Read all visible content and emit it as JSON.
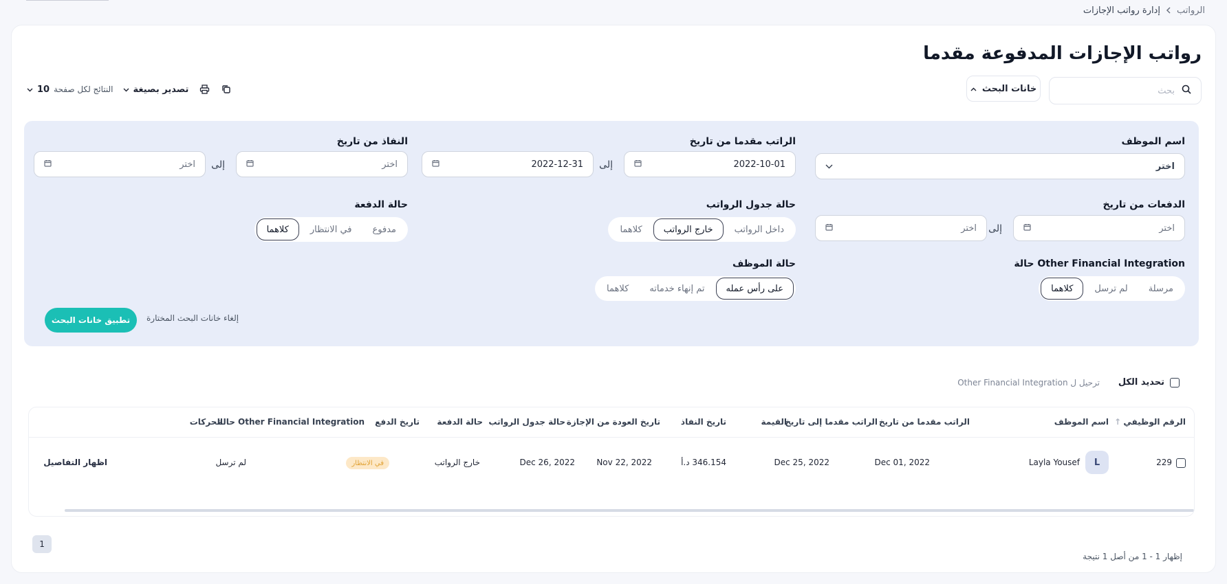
{
  "breadcrumb": {
    "root": "الرواتب",
    "current": "إدارة رواتب الإجازات"
  },
  "page": {
    "title": "رواتب الإجازات المدفوعة مقدما"
  },
  "search": {
    "placeholder": "بحث",
    "fields_button": "خانات البحث"
  },
  "toolbar": {
    "export_label": "تصدير بصيغة",
    "per_page_label": "النتائج لكل صفحة",
    "per_page_value": "10"
  },
  "filters": {
    "employee_name": {
      "label": "اسم الموظف",
      "placeholder": "اختر"
    },
    "advance_from": {
      "label": "الراتب مقدما من تاريخ",
      "from_value": "2022-10-01",
      "to_value": "2022-12-31",
      "to_word": "إلى"
    },
    "effective_from": {
      "label": "النفاذ من تاريخ",
      "from_placeholder": "اختر",
      "to_placeholder": "اختر",
      "to_word": "إلى"
    },
    "payments_from": {
      "label": "الدفعات من تاريخ",
      "from_placeholder": "اختر",
      "to_placeholder": "اختر",
      "to_word": "إلى"
    },
    "payroll_status": {
      "label": "حالة جدول الرواتب",
      "options": [
        "داخل الرواتب",
        "خارج الرواتب",
        "كلاهما"
      ],
      "selected": "خارج الرواتب"
    },
    "payment_status": {
      "label": "حالة الدفعة",
      "options": [
        "مدفوع",
        "في الانتظار",
        "كلاهما"
      ],
      "selected": "كلاهما"
    },
    "ofi_status": {
      "label": "Other Financial Integration حالة",
      "options": [
        "مرسلة",
        "لم ترسل",
        "كلاهما"
      ],
      "selected": "كلاهما"
    },
    "employee_status": {
      "label": "حالة الموظف",
      "options": [
        "على رأس عمله",
        "تم إنهاء خدماته",
        "كلاهما"
      ],
      "selected": "على رأس عمله"
    },
    "apply_label": "تطبيق خانات البحث",
    "clear_label": "إلغاء خانات البحث المختارة"
  },
  "bulk": {
    "select_all": "تحديد الكل",
    "transfer": "ترحيل ل Other Financial Integration"
  },
  "table": {
    "headers": {
      "emp_no": "الرقم الوظيفي",
      "emp_name": "اسم الموظف",
      "adv_from": "الراتب مقدما من تاريخ",
      "adv_to": "الراتب مقدما إلى تاريخ",
      "amount": "القيمة",
      "effective": "تاريخ النفاذ",
      "return": "تاريخ العودة من الإجازة",
      "payroll": "حالة جدول الرواتب",
      "payment": "حالة الدفعة",
      "paid_date": "تاريخ الدفع",
      "ofi": "Other Financial Integration حالة",
      "actions": "الحركات"
    },
    "rows": [
      {
        "emp_no": "229",
        "avatar": "L",
        "emp_name": "Layla Yousef",
        "adv_from": "Dec 01, 2022",
        "adv_to": "Dec 25, 2022",
        "amount": "346.154 د.أ",
        "effective": "Nov 22, 2022",
        "return": "Dec 26, 2022",
        "payroll": "خارج الرواتب",
        "payment": "في الانتظار",
        "paid_date": "",
        "ofi": "لم ترسل",
        "actions": "اظهار التفاصيل"
      }
    ]
  },
  "pagination": {
    "current": "1",
    "summary": "إظهار 1 - 1 من أصل 1 نتيجة"
  },
  "colors": {
    "accent": "#1bbfb5",
    "panel": "#e8edf9",
    "pending_bg": "#fde8c7",
    "pending_fg": "#e0a235"
  }
}
